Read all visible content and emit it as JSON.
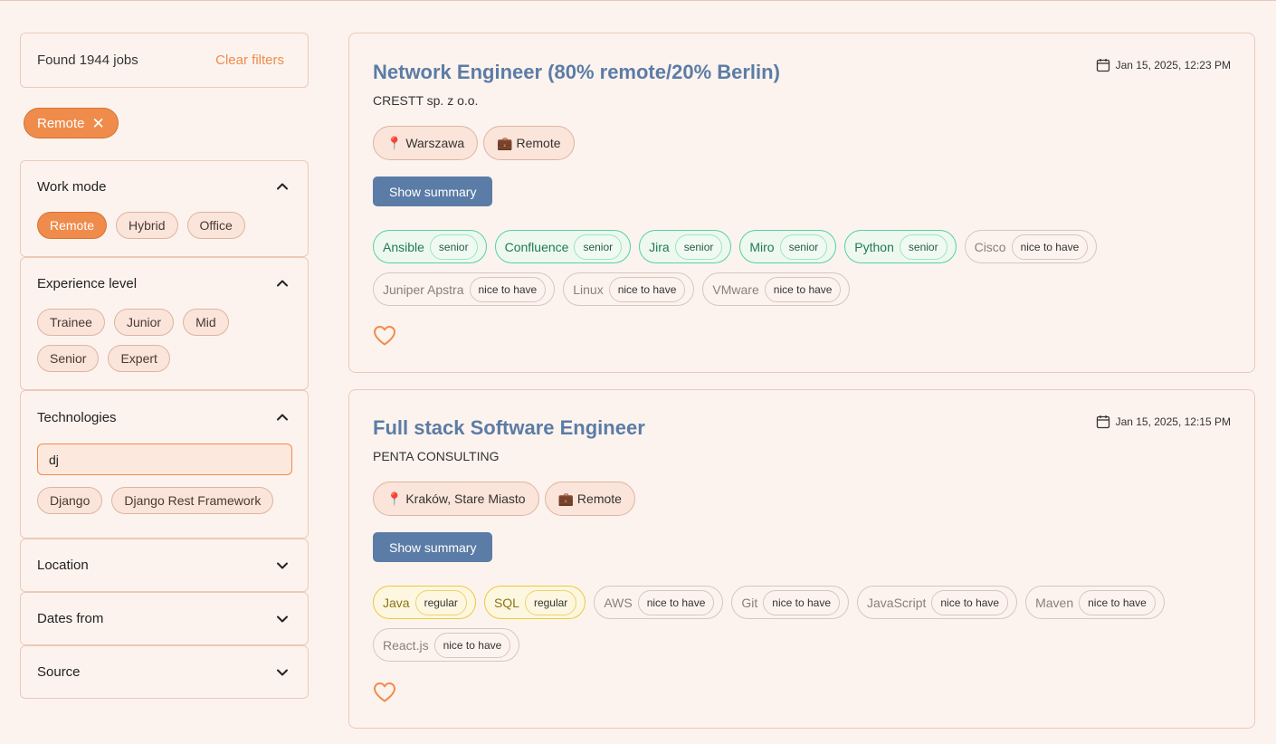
{
  "colors": {
    "accent": "#ef8c4c",
    "title": "#5b7ca6",
    "senior": "#52d49c",
    "regular": "#e6cc3c"
  },
  "filters": {
    "found_text": "Found 1944 jobs",
    "clear_label": "Clear filters",
    "active": [
      {
        "label": "Remote"
      }
    ],
    "work_mode": {
      "title": "Work mode",
      "options": [
        "Remote",
        "Hybrid",
        "Office"
      ]
    },
    "experience": {
      "title": "Experience level",
      "options": [
        "Trainee",
        "Junior",
        "Mid",
        "Senior",
        "Expert"
      ]
    },
    "technologies": {
      "title": "Technologies",
      "input_value": "dj",
      "options": [
        "Django",
        "Django Rest Framework"
      ]
    },
    "location": {
      "title": "Location"
    },
    "dates_from": {
      "title": "Dates from"
    },
    "source": {
      "title": "Source"
    }
  },
  "jobs": [
    {
      "title": "Network Engineer (80% remote/20% Berlin)",
      "company": "CRESTT sp. z o.o.",
      "date": "Jan 15, 2025, 12:23 PM",
      "location": "📍 Warszawa",
      "work_mode": "💼 Remote",
      "summary_label": "Show summary",
      "skills": [
        {
          "name": "Ansible",
          "level": "senior"
        },
        {
          "name": "Confluence",
          "level": "senior"
        },
        {
          "name": "Jira",
          "level": "senior"
        },
        {
          "name": "Miro",
          "level": "senior"
        },
        {
          "name": "Python",
          "level": "senior"
        },
        {
          "name": "Cisco",
          "level": "nice to have"
        },
        {
          "name": "Juniper Apstra",
          "level": "nice to have"
        },
        {
          "name": "Linux",
          "level": "nice to have"
        },
        {
          "name": "VMware",
          "level": "nice to have"
        }
      ]
    },
    {
      "title": "Full stack Software Engineer",
      "company": "PENTA CONSULTING",
      "date": "Jan 15, 2025, 12:15 PM",
      "location": "📍 Kraków, Stare Miasto",
      "work_mode": "💼 Remote",
      "summary_label": "Show summary",
      "skills": [
        {
          "name": "Java",
          "level": "regular"
        },
        {
          "name": "SQL",
          "level": "regular"
        },
        {
          "name": "AWS",
          "level": "nice to have"
        },
        {
          "name": "Git",
          "level": "nice to have"
        },
        {
          "name": "JavaScript",
          "level": "nice to have"
        },
        {
          "name": "Maven",
          "level": "nice to have"
        },
        {
          "name": "React.js",
          "level": "nice to have"
        }
      ]
    }
  ]
}
